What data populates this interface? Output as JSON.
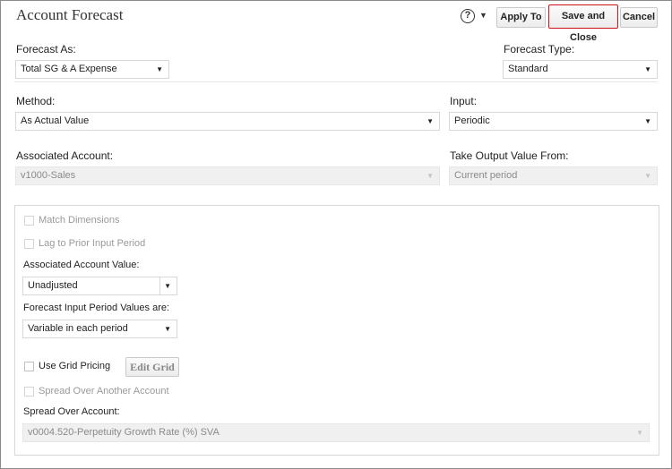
{
  "header": {
    "title": "Account Forecast",
    "help_glyph": "?",
    "help_caret": "▼",
    "apply_label": "Apply To",
    "save_close_label": "Save and Close",
    "cancel_label": "Cancel"
  },
  "forecast_as": {
    "label": "Forecast As:",
    "value": "Total SG & A Expense"
  },
  "forecast_type": {
    "label": "Forecast Type:",
    "value": "Standard"
  },
  "method": {
    "label": "Method:",
    "value": "As Actual Value"
  },
  "input": {
    "label": "Input:",
    "value": "Periodic"
  },
  "associated_account": {
    "label": "Associated Account:",
    "value": "v1000-Sales"
  },
  "take_output": {
    "label": "Take Output Value From:",
    "value": "Current period"
  },
  "panel": {
    "match_dimensions": "Match Dimensions",
    "lag_prior": "Lag to Prior Input Period",
    "assoc_value_label": "Associated Account Value:",
    "assoc_value": "Unadjusted",
    "input_period_label": "Forecast Input Period Values are:",
    "input_period_value": "Variable in each period",
    "use_grid_pricing": "Use Grid Pricing",
    "edit_grid": "Edit Grid",
    "spread_another": "Spread Over Another Account",
    "spread_account_label": "Spread Over Account:",
    "spread_account_value": "v0004.520-Perpetuity Growth Rate (%) SVA"
  },
  "caret": "▼"
}
